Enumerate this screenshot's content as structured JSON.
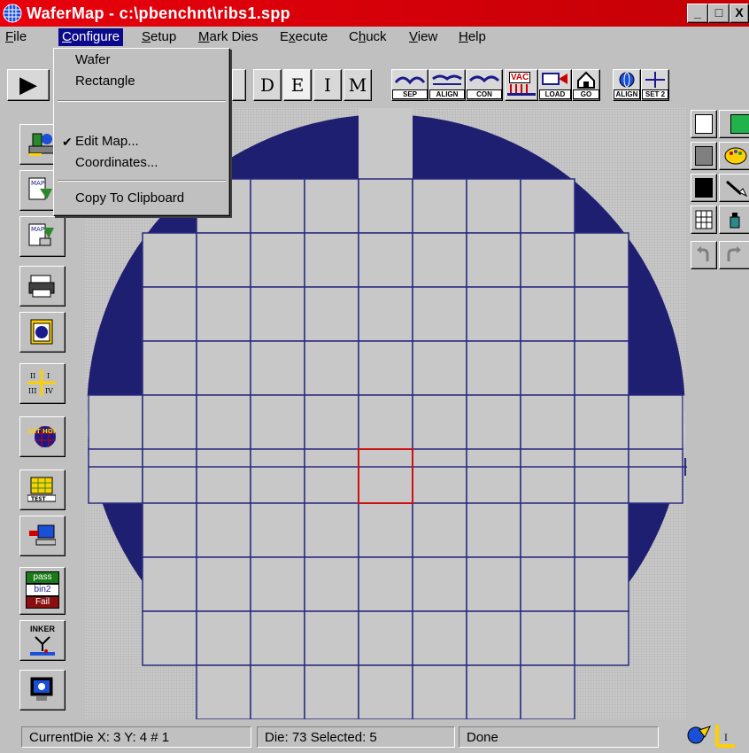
{
  "window": {
    "title": "WaferMap - c:\\pbenchnt\\ribs1.spp",
    "controls": {
      "minimize": "_",
      "maximize": "□",
      "close": "X"
    }
  },
  "menubar": {
    "items": [
      {
        "label": "File",
        "active": false
      },
      {
        "label": "Configure",
        "active": true
      },
      {
        "label": "Setup",
        "active": false
      },
      {
        "label": "Mark Dies",
        "active": false
      },
      {
        "label": "Execute",
        "active": false
      },
      {
        "label": "Chuck",
        "active": false
      },
      {
        "label": "View",
        "active": false
      },
      {
        "label": "Help",
        "active": false
      }
    ]
  },
  "configure_menu": {
    "items": [
      {
        "label": "Wafer",
        "checked": false
      },
      {
        "label": "Rectangle",
        "checked": false
      },
      {
        "label": "Edit Map...",
        "checked": true
      },
      {
        "label": "Coordinates...",
        "checked": false
      },
      {
        "label": "Copy To Clipboard",
        "checked": false
      }
    ],
    "check_glyph": "✔"
  },
  "toolbar": {
    "play_glyph": "▶",
    "mode_buttons": [
      "D",
      "E",
      "I",
      "M"
    ],
    "icon_labels": [
      "SEP",
      "ALIGN",
      "CON",
      "VAC",
      "LOAD",
      "GO",
      "ALIGN",
      "SET 2"
    ]
  },
  "sidebar": {
    "icons": [
      "probe-station-icon",
      "map-load-icon",
      "map-save-icon",
      "printer-icon",
      "clipboard-wafer-icon",
      "quadrant-axes-icon",
      "set-home-icon",
      "test-grid-icon",
      "computer-probe-icon",
      "bin-results-icon",
      "inker-icon",
      "monitor-icon"
    ],
    "bin_labels": [
      "pass",
      "bin2",
      "Fail"
    ],
    "set_home_label": "SET HOME",
    "test_label": "TEST",
    "inker_label": "INKER"
  },
  "palette": {
    "colors": [
      "#ffffff",
      "#808080",
      "#000000"
    ],
    "accent_green": "#22b24c"
  },
  "wafer": {
    "wafer_color": "#1f1f72",
    "grid_color": "#2a2a80",
    "selected_die_color": "#cc1111",
    "die_fill": "#c8c8c8"
  },
  "statusbar": {
    "current_die": "CurrentDie X: 3  Y: 4  # 1",
    "die_info": "Die: 73  Selected:  5",
    "state": "Done"
  }
}
